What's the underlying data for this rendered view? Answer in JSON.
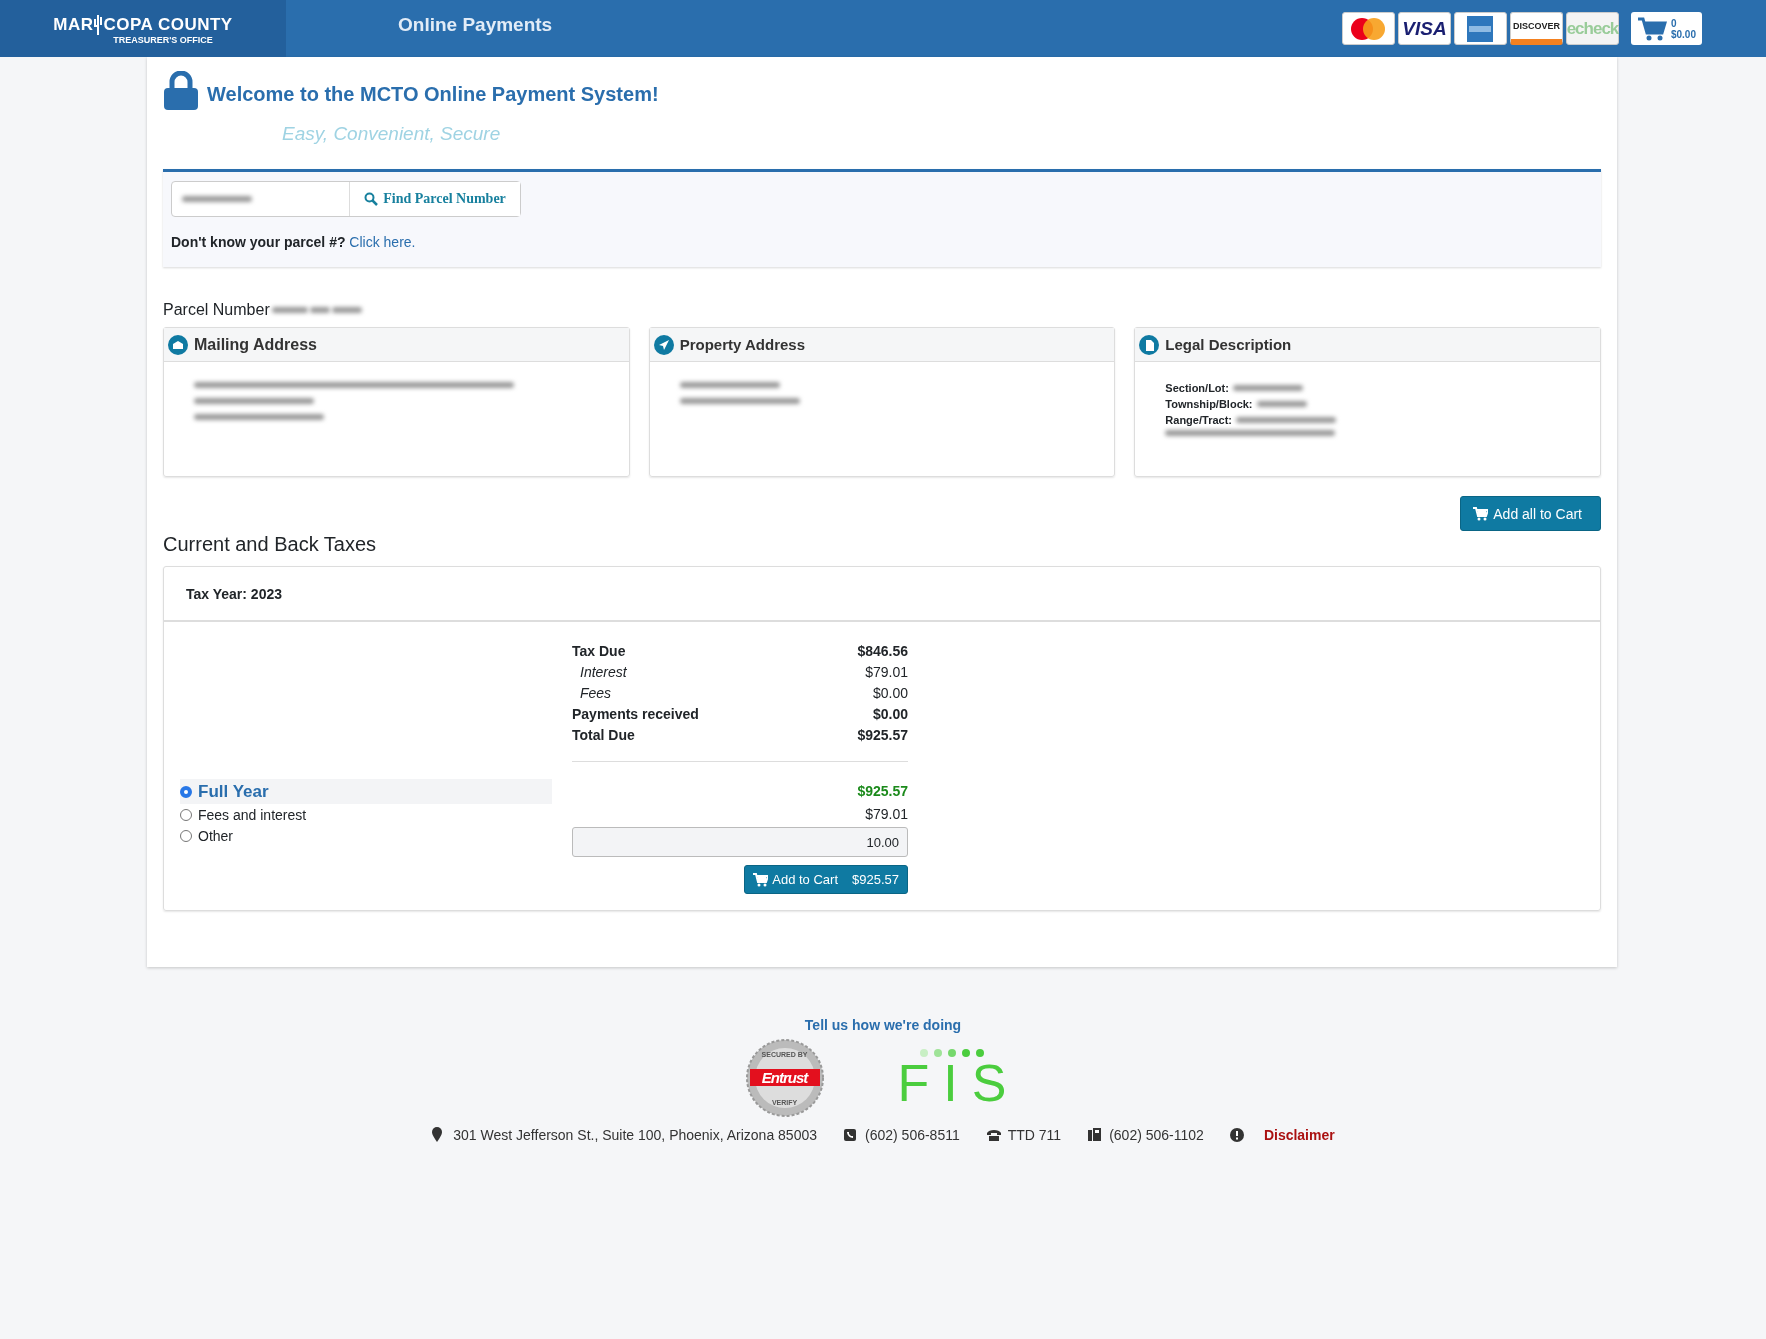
{
  "header": {
    "logo": {
      "left": "MAR",
      "right": "COPA COUNTY",
      "sub": "TREASURER'S OFFICE"
    },
    "title": "Online Payments",
    "payment_logos": [
      {
        "kind": "mastercard"
      },
      {
        "kind": "visa",
        "text": "VISA"
      },
      {
        "kind": "amex"
      },
      {
        "kind": "discover",
        "text": "DISCOVER"
      },
      {
        "kind": "echeck",
        "text": "echeck"
      }
    ],
    "cart": {
      "count": "0",
      "total": "$0.00"
    }
  },
  "welcome": {
    "title": "Welcome to the MCTO Online Payment System!",
    "tagline": "Easy, Convenient, Secure"
  },
  "search": {
    "button": "Find Parcel Number",
    "help": "Don't know your parcel #?",
    "link": "Click here."
  },
  "parcel_label": "Parcel Number",
  "cards": [
    {
      "kind": "mailing",
      "title": "Mailing Address"
    },
    {
      "kind": "property",
      "title": "Property Address"
    },
    {
      "kind": "legal",
      "title": "Legal Description",
      "fields": [
        "Section/Lot:",
        "Township/Block:",
        "Range/Tract:"
      ]
    }
  ],
  "add_all_button": "Add all to Cart",
  "section_title": "Current and Back Taxes",
  "tax": {
    "year_label": "Tax Year: 2023",
    "lines": [
      {
        "kind": "total",
        "label": "Tax Due",
        "value": "$846.56"
      },
      {
        "kind": "component",
        "label": "Interest",
        "value": "$79.01"
      },
      {
        "kind": "component",
        "label": "Fees",
        "value": "$0.00"
      },
      {
        "kind": "total",
        "label": "Payments received",
        "value": "$0.00"
      },
      {
        "kind": "total",
        "label": "Total Due",
        "value": "$925.57"
      }
    ],
    "options": [
      {
        "kind": "amount",
        "label": "Full Year",
        "selected": true,
        "amount": "$925.57"
      },
      {
        "kind": "amount",
        "label": "Fees and interest",
        "selected": false,
        "amount": "$79.01"
      },
      {
        "kind": "input",
        "label": "Other",
        "selected": false,
        "value": "10.00"
      }
    ],
    "add_button": {
      "label": "Add to Cart",
      "amount": "$925.57"
    }
  },
  "footer": {
    "feedback": "Tell us how we're doing",
    "seal": {
      "top": "SECURED BY",
      "brand": "Entrust",
      "bottom": "VERIFY"
    },
    "fis": "FIS",
    "contacts": [
      {
        "kind": "location",
        "text": "301 West Jefferson St., Suite 100, Phoenix, Arizona 85003"
      },
      {
        "kind": "phone",
        "text": "(602) 506-8511"
      },
      {
        "kind": "tty",
        "text": "TTD 711"
      },
      {
        "kind": "fax",
        "text": "(602) 506-1102"
      }
    ],
    "disclaimer": "Disclaimer"
  }
}
